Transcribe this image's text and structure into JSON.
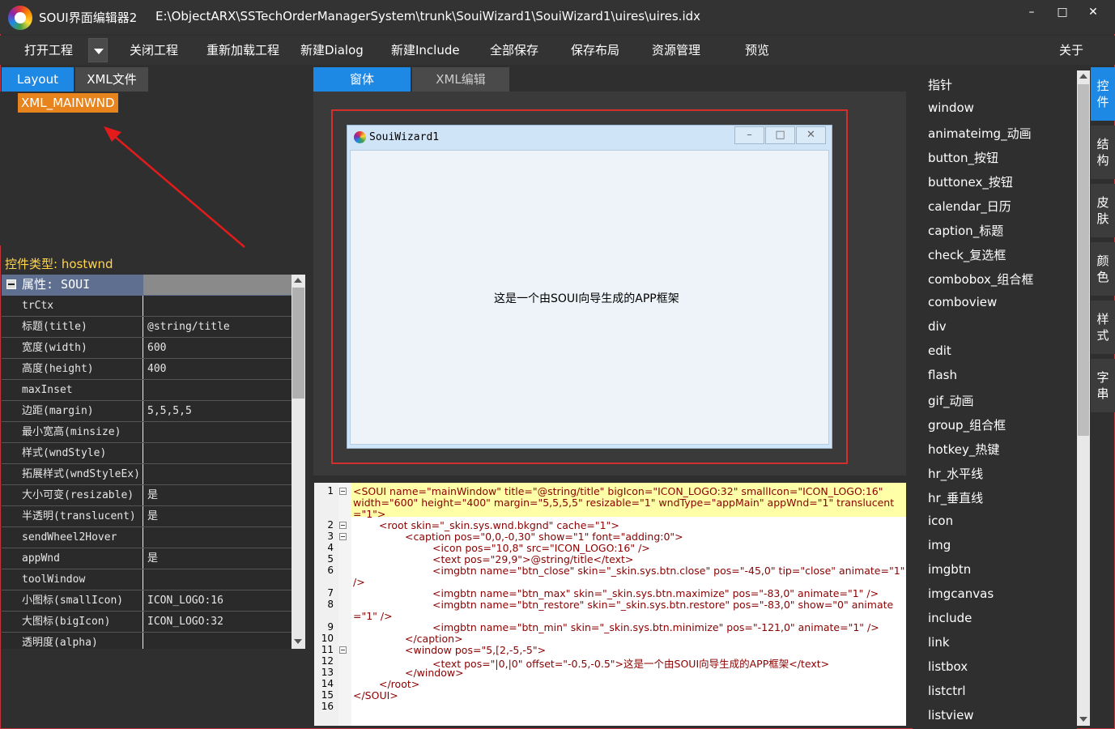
{
  "titlebar": {
    "app_title": "SOUI界面编辑器2",
    "path": "E:\\ObjectARX\\SSTechOrderManagerSystem\\trunk\\SouiWizard1\\SouiWizard1\\uires\\uires.idx"
  },
  "toolbar": {
    "open": "打开工程",
    "close": "关闭工程",
    "reload": "重新加载工程",
    "new_dialog": "新建Dialog",
    "new_include": "新建Include",
    "save_all": "全部保存",
    "save_layout": "保存布局",
    "resources": "资源管理",
    "preview": "预览",
    "about": "关于"
  },
  "left": {
    "tab_layout": "Layout",
    "tab_xml": "XML文件",
    "tree_node": "XML_MAINWND",
    "ctl_type": "控件类型: hostwnd",
    "prop_header": "属性: SOUI"
  },
  "props": [
    {
      "k": "trCtx",
      "v": ""
    },
    {
      "k": "标题(title)",
      "v": "@string/title"
    },
    {
      "k": "宽度(width)",
      "v": "600"
    },
    {
      "k": "高度(height)",
      "v": "400"
    },
    {
      "k": "maxInset",
      "v": ""
    },
    {
      "k": "边距(margin)",
      "v": "5,5,5,5"
    },
    {
      "k": "最小宽高(minsize)",
      "v": ""
    },
    {
      "k": "样式(wndStyle)",
      "v": ""
    },
    {
      "k": "拓展样式(wndStyleEx)",
      "v": ""
    },
    {
      "k": "大小可变(resizable)",
      "v": "是"
    },
    {
      "k": "半透明(translucent)",
      "v": "是"
    },
    {
      "k": "sendWheel2Hover",
      "v": ""
    },
    {
      "k": "appWnd",
      "v": "是"
    },
    {
      "k": "toolWindow",
      "v": ""
    },
    {
      "k": "小图标(smallIcon)",
      "v": "ICON_LOGO:16"
    },
    {
      "k": "大图标(bigIcon)",
      "v": "ICON_LOGO:32"
    },
    {
      "k": "透明度(alpha)",
      "v": ""
    }
  ],
  "center": {
    "tab_window": "窗体",
    "tab_xml_edit": "XML编辑",
    "preview_title": "SouiWizard1",
    "preview_text": "这是一个由SOUI向导生成的APP框架",
    "min": "–",
    "max": "□",
    "close": "✕"
  },
  "code_lines": [
    "<SOUI name=\"mainWindow\" title=\"@string/title\" bigIcon=\"ICON_LOGO:32\" smallIcon=\"ICON_LOGO:16\"",
    "width=\"600\" height=\"400\" margin=\"5,5,5,5\" resizable=\"1\" wndType=\"appMain\" appWnd=\"1\" translucent",
    "=\"1\">",
    "<root skin=\"_skin.sys.wnd.bkgnd\" cache=\"1\">",
    "<caption pos=\"0,0,-0,30\" show=\"1\" font=\"adding:0\">",
    "<icon pos=\"10,8\" src=\"ICON_LOGO:16\" />",
    "<text pos=\"29,9\">@string/title</text>",
    "<imgbtn name=\"btn_close\" skin=\"_skin.sys.btn.close\" pos=\"-45,0\" tip=\"close\" animate=\"1\"",
    "/>",
    "<imgbtn name=\"btn_max\" skin=\"_skin.sys.btn.maximize\" pos=\"-83,0\" animate=\"1\" />",
    "<imgbtn name=\"btn_restore\" skin=\"_skin.sys.btn.restore\" pos=\"-83,0\" show=\"0\" animate",
    "=\"1\" />",
    "<imgbtn name=\"btn_min\" skin=\"_skin.sys.btn.minimize\" pos=\"-121,0\" animate=\"1\" />",
    "</caption>",
    "<window pos=\"5,[2,-5,-5\">",
    "<text pos=\"|0,|0\" offset=\"-0.5,-0.5\">这是一个由SOUI向导生成的APP框架</text>",
    "</window>",
    "</root>",
    "</SOUI>"
  ],
  "line_numbers": [
    "1",
    "2",
    "3",
    "4",
    "5",
    "6",
    "7",
    "8",
    "9",
    "10",
    "11",
    "12",
    "13",
    "14",
    "15",
    "16"
  ],
  "toolbox": [
    "指针",
    "window",
    "animateimg_动画",
    "button_按钮",
    "buttonex_按钮",
    "calendar_日历",
    "caption_标题",
    "check_复选框",
    "combobox_组合框",
    "comboview",
    "div",
    "edit",
    "flash",
    "gif_动画",
    "group_组合框",
    "hotkey_热键",
    "hr_水平线",
    "hr_垂直线",
    "icon",
    "img",
    "imgbtn",
    "imgcanvas",
    "include",
    "link",
    "listbox",
    "listctrl",
    "listview"
  ],
  "side_tabs": [
    "控件",
    "结构",
    "皮肤",
    "颜色",
    "样式",
    "字串"
  ],
  "colors": {
    "accent": "#1e88e5",
    "node": "#e8841e",
    "frame": "#d32f2f"
  }
}
